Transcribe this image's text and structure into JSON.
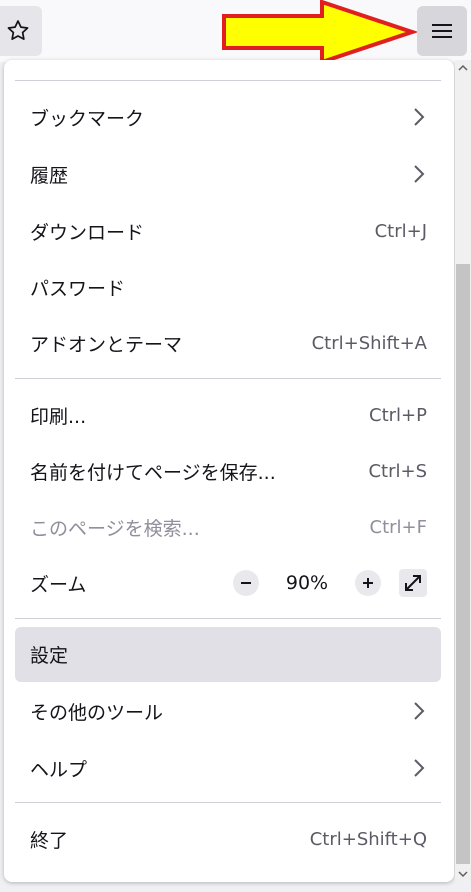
{
  "toolbar": {
    "bookmark_star_icon": "star-icon",
    "app_menu_icon": "hamburger-icon"
  },
  "annotation": {
    "arrow_color": "#ffff00",
    "arrow_outline": "#e02020"
  },
  "menu": {
    "bookmarks": "ブックマーク",
    "history": "履歴",
    "downloads": {
      "label": "ダウンロード",
      "shortcut": "Ctrl+J"
    },
    "passwords": "パスワード",
    "addons": {
      "label": "アドオンとテーマ",
      "shortcut": "Ctrl+Shift+A"
    },
    "print": {
      "label": "印刷...",
      "shortcut": "Ctrl+P"
    },
    "save_page": {
      "label": "名前を付けてページを保存...",
      "shortcut": "Ctrl+S"
    },
    "find": {
      "label": "このページを検索...",
      "shortcut": "Ctrl+F"
    },
    "zoom": {
      "label": "ズーム",
      "minus": "−",
      "value": "90%",
      "plus": "+"
    },
    "settings": "設定",
    "more_tools": "その他のツール",
    "help": "ヘルプ",
    "quit": {
      "label": "終了",
      "shortcut": "Ctrl+Shift+Q"
    }
  }
}
